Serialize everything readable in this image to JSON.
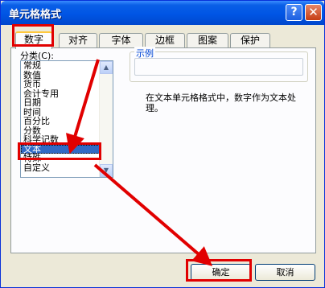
{
  "window": {
    "title": "单元格格式"
  },
  "titlebar_buttons": {
    "help": "?",
    "close": "✕"
  },
  "tabs": [
    {
      "label": "数字"
    },
    {
      "label": "对齐"
    },
    {
      "label": "字体"
    },
    {
      "label": "边框"
    },
    {
      "label": "图案"
    },
    {
      "label": "保护"
    }
  ],
  "category": {
    "label": "分类(C):",
    "items": [
      "常规",
      "数值",
      "货币",
      "会计专用",
      "日期",
      "时间",
      "百分比",
      "分数",
      "科学记数",
      "文本",
      "特殊",
      "自定义"
    ],
    "selected": "文本"
  },
  "sample": {
    "label": "示例",
    "value": ""
  },
  "description": "在文本单元格格式中，数字作为文本处理。",
  "buttons": {
    "ok": "确定",
    "cancel": "取消"
  },
  "annotation_color": "#e10000"
}
